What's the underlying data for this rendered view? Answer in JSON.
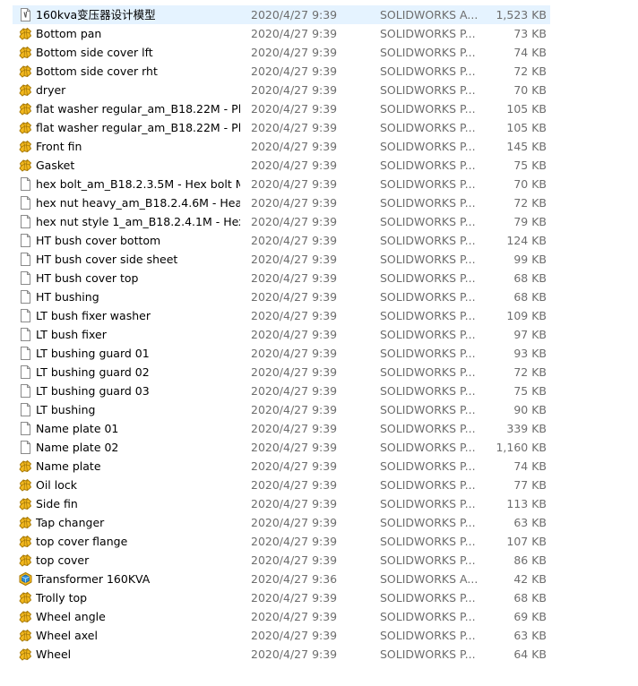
{
  "files": [
    {
      "icon": "asm-doc-icon",
      "name": "160kva变压器设计模型",
      "date": "2020/4/27 9:39",
      "type": "SOLIDWORKS A...",
      "size": "1,523 KB",
      "selected": true
    },
    {
      "icon": "sw-part-icon",
      "name": "Bottom pan",
      "date": "2020/4/27 9:39",
      "type": "SOLIDWORKS P...",
      "size": "73 KB"
    },
    {
      "icon": "sw-part-icon",
      "name": "Bottom side cover lft",
      "date": "2020/4/27 9:39",
      "type": "SOLIDWORKS P...",
      "size": "74 KB"
    },
    {
      "icon": "sw-part-icon",
      "name": "Bottom side cover rht",
      "date": "2020/4/27 9:39",
      "type": "SOLIDWORKS P...",
      "size": "72 KB"
    },
    {
      "icon": "sw-part-icon",
      "name": "dryer",
      "date": "2020/4/27 9:39",
      "type": "SOLIDWORKS P...",
      "size": "70 KB"
    },
    {
      "icon": "sw-part-icon",
      "name": "flat washer regular_am_B18.22M - Pl...",
      "date": "2020/4/27 9:39",
      "type": "SOLIDWORKS P...",
      "size": "105 KB"
    },
    {
      "icon": "sw-part-icon",
      "name": "flat washer regular_am_B18.22M - Pl...",
      "date": "2020/4/27 9:39",
      "type": "SOLIDWORKS P...",
      "size": "105 KB"
    },
    {
      "icon": "sw-part-icon",
      "name": "Front fin",
      "date": "2020/4/27 9:39",
      "type": "SOLIDWORKS P...",
      "size": "145 KB"
    },
    {
      "icon": "sw-part-icon",
      "name": "Gasket",
      "date": "2020/4/27 9:39",
      "type": "SOLIDWORKS P...",
      "size": "75 KB"
    },
    {
      "icon": "blank-file-icon",
      "name": "hex bolt_am_B18.2.3.5M - Hex bolt M...",
      "date": "2020/4/27 9:39",
      "type": "SOLIDWORKS P...",
      "size": "70 KB"
    },
    {
      "icon": "blank-file-icon",
      "name": "hex nut heavy_am_B18.2.4.6M - Heav...",
      "date": "2020/4/27 9:39",
      "type": "SOLIDWORKS P...",
      "size": "72 KB"
    },
    {
      "icon": "blank-file-icon",
      "name": "hex nut style 1_am_B18.2.4.1M - Hex ...",
      "date": "2020/4/27 9:39",
      "type": "SOLIDWORKS P...",
      "size": "79 KB"
    },
    {
      "icon": "blank-file-icon",
      "name": "HT bush cover bottom",
      "date": "2020/4/27 9:39",
      "type": "SOLIDWORKS P...",
      "size": "124 KB"
    },
    {
      "icon": "blank-file-icon",
      "name": "HT bush cover side sheet",
      "date": "2020/4/27 9:39",
      "type": "SOLIDWORKS P...",
      "size": "99 KB"
    },
    {
      "icon": "blank-file-icon",
      "name": "HT bush cover top",
      "date": "2020/4/27 9:39",
      "type": "SOLIDWORKS P...",
      "size": "68 KB"
    },
    {
      "icon": "blank-file-icon",
      "name": "HT bushing",
      "date": "2020/4/27 9:39",
      "type": "SOLIDWORKS P...",
      "size": "68 KB"
    },
    {
      "icon": "blank-file-icon",
      "name": "LT bush fixer washer",
      "date": "2020/4/27 9:39",
      "type": "SOLIDWORKS P...",
      "size": "109 KB"
    },
    {
      "icon": "blank-file-icon",
      "name": "LT bush fixer",
      "date": "2020/4/27 9:39",
      "type": "SOLIDWORKS P...",
      "size": "97 KB"
    },
    {
      "icon": "blank-file-icon",
      "name": "LT bushing guard 01",
      "date": "2020/4/27 9:39",
      "type": "SOLIDWORKS P...",
      "size": "93 KB"
    },
    {
      "icon": "blank-file-icon",
      "name": "LT bushing guard 02",
      "date": "2020/4/27 9:39",
      "type": "SOLIDWORKS P...",
      "size": "72 KB"
    },
    {
      "icon": "blank-file-icon",
      "name": "LT bushing guard 03",
      "date": "2020/4/27 9:39",
      "type": "SOLIDWORKS P...",
      "size": "75 KB"
    },
    {
      "icon": "blank-file-icon",
      "name": "LT bushing",
      "date": "2020/4/27 9:39",
      "type": "SOLIDWORKS P...",
      "size": "90 KB"
    },
    {
      "icon": "blank-file-icon",
      "name": "Name plate 01",
      "date": "2020/4/27 9:39",
      "type": "SOLIDWORKS P...",
      "size": "339 KB"
    },
    {
      "icon": "blank-file-icon",
      "name": "Name plate 02",
      "date": "2020/4/27 9:39",
      "type": "SOLIDWORKS P...",
      "size": "1,160 KB"
    },
    {
      "icon": "sw-part-icon",
      "name": "Name plate",
      "date": "2020/4/27 9:39",
      "type": "SOLIDWORKS P...",
      "size": "74 KB"
    },
    {
      "icon": "sw-part-icon",
      "name": "Oil lock",
      "date": "2020/4/27 9:39",
      "type": "SOLIDWORKS P...",
      "size": "77 KB"
    },
    {
      "icon": "sw-part-icon",
      "name": "Side fin",
      "date": "2020/4/27 9:39",
      "type": "SOLIDWORKS P...",
      "size": "113 KB"
    },
    {
      "icon": "sw-part-icon",
      "name": "Tap changer",
      "date": "2020/4/27 9:39",
      "type": "SOLIDWORKS P...",
      "size": "63 KB"
    },
    {
      "icon": "sw-part-icon",
      "name": "top cover flange",
      "date": "2020/4/27 9:39",
      "type": "SOLIDWORKS P...",
      "size": "107 KB"
    },
    {
      "icon": "sw-part-icon",
      "name": "top cover",
      "date": "2020/4/27 9:39",
      "type": "SOLIDWORKS P...",
      "size": "86 KB"
    },
    {
      "icon": "sw-assembly-icon",
      "name": "Transformer 160KVA",
      "date": "2020/4/27 9:36",
      "type": "SOLIDWORKS A...",
      "size": "42 KB"
    },
    {
      "icon": "sw-part-icon",
      "name": "Trolly top",
      "date": "2020/4/27 9:39",
      "type": "SOLIDWORKS P...",
      "size": "68 KB"
    },
    {
      "icon": "sw-part-icon",
      "name": "Wheel angle",
      "date": "2020/4/27 9:39",
      "type": "SOLIDWORKS P...",
      "size": "69 KB"
    },
    {
      "icon": "sw-part-icon",
      "name": "Wheel axel",
      "date": "2020/4/27 9:39",
      "type": "SOLIDWORKS P...",
      "size": "63 KB"
    },
    {
      "icon": "sw-part-icon",
      "name": "Wheel",
      "date": "2020/4/27 9:39",
      "type": "SOLIDWORKS P...",
      "size": "64 KB"
    }
  ],
  "colors": {
    "selected_row": "#e5f3ff",
    "part_icon_yellow": "#f2b81e",
    "part_icon_outline": "#a87a08",
    "assembly_icon_blue": "#2f8fd8",
    "secondary_text": "#6d6d6d"
  }
}
